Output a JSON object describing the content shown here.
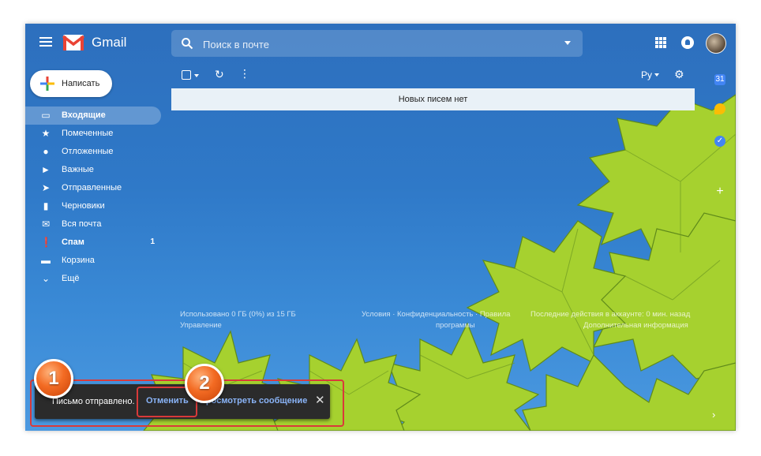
{
  "header": {
    "app_name": "Gmail",
    "search_placeholder": "Поиск в почте"
  },
  "compose": {
    "label": "Написать"
  },
  "sidebar": {
    "items": [
      {
        "label": "Входящие",
        "icon": "inbox-icon",
        "active": true,
        "bold": true
      },
      {
        "label": "Помеченные",
        "icon": "star-icon"
      },
      {
        "label": "Отложенные",
        "icon": "clock-icon"
      },
      {
        "label": "Важные",
        "icon": "important-icon"
      },
      {
        "label": "Отправленные",
        "icon": "send-icon"
      },
      {
        "label": "Черновики",
        "icon": "draft-icon"
      },
      {
        "label": "Вся почта",
        "icon": "mail-icon"
      },
      {
        "label": "Спам",
        "icon": "spam-icon",
        "bold": true,
        "count": "1"
      },
      {
        "label": "Корзина",
        "icon": "trash-icon"
      },
      {
        "label": "Ещё",
        "icon": "chevron-down-icon"
      }
    ]
  },
  "toolbar": {
    "language": "Ру"
  },
  "main": {
    "empty_message": "Новых писем нет"
  },
  "footer": {
    "storage": "Использовано 0 ГБ (0%) из 15 ГБ",
    "manage": "Управление",
    "terms": "Условия · Конфиденциальность · Правила",
    "programs": "программы",
    "last_activity": "Последние действия в аккаунте: 0 мин. назад",
    "details": "Дополнительная информация"
  },
  "snackbar": {
    "message": "Письмо отправлено.",
    "undo": "Отменить",
    "view": "Просмотреть сообщение"
  },
  "annotations": {
    "badge_1": "1",
    "badge_2": "2"
  },
  "colors": {
    "background_blue": "#2f79c8",
    "leaf_green": "#a6d12f",
    "highlight_red": "#d93a3a",
    "badge_orange": "#f36b23",
    "link_blue": "#8ab4f8"
  }
}
